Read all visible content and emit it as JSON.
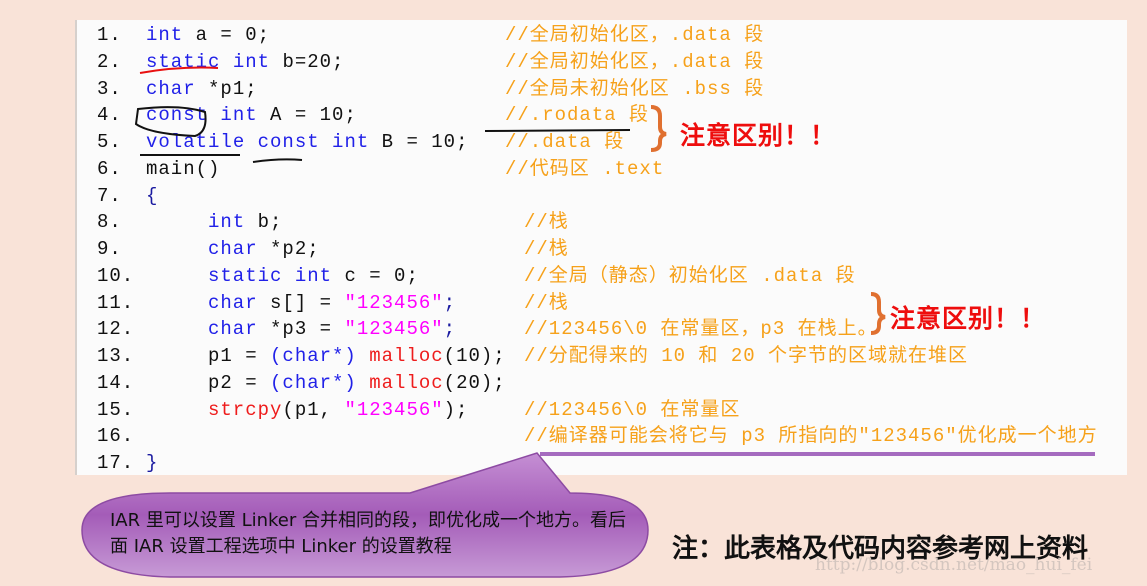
{
  "code_lines": [
    {
      "num": "1.",
      "indent": 0,
      "tokens": [
        [
          "int",
          "k"
        ],
        [
          " a = 0;",
          "p"
        ]
      ],
      "comment": "//全局初始化区，.data 段"
    },
    {
      "num": "2.",
      "indent": 0,
      "tokens": [
        [
          "static",
          "k"
        ],
        [
          " ",
          "p"
        ],
        [
          "int",
          "k"
        ],
        [
          " b=20;",
          "p"
        ]
      ],
      "comment": "//全局初始化区，.data 段"
    },
    {
      "num": "3.",
      "indent": 0,
      "tokens": [
        [
          "char",
          "k"
        ],
        [
          " *p1;",
          "p"
        ]
      ],
      "comment": "//全局未初始化区 .bss 段"
    },
    {
      "num": "4.",
      "indent": 0,
      "tokens": [
        [
          "const",
          "k"
        ],
        [
          " ",
          "p"
        ],
        [
          "int",
          "k"
        ],
        [
          " A = 10;",
          "p"
        ]
      ],
      "comment": "//.rodata 段"
    },
    {
      "num": "5.",
      "indent": 0,
      "tokens": [
        [
          "volatile",
          "k"
        ],
        [
          " ",
          "p"
        ],
        [
          "const",
          "k"
        ],
        [
          " ",
          "p"
        ],
        [
          "int",
          "k"
        ],
        [
          " B = 10;",
          "p"
        ]
      ],
      "comment": "//.data 段"
    },
    {
      "num": "6.",
      "indent": 0,
      "tokens": [
        [
          "main()",
          "p"
        ]
      ],
      "comment": "//代码区 .text"
    },
    {
      "num": "7.",
      "indent": 0,
      "tokens": [
        [
          "{",
          "b"
        ]
      ],
      "comment": ""
    },
    {
      "num": "8.",
      "indent": 1,
      "tokens": [
        [
          "int",
          "k"
        ],
        [
          " b;",
          "p"
        ]
      ],
      "comment": "//栈"
    },
    {
      "num": "9.",
      "indent": 1,
      "tokens": [
        [
          "char",
          "k"
        ],
        [
          " *p2;",
          "p"
        ]
      ],
      "comment": "//栈"
    },
    {
      "num": "10.",
      "indent": 1,
      "tokens": [
        [
          "static",
          "k"
        ],
        [
          " ",
          "p"
        ],
        [
          "int",
          "k"
        ],
        [
          " c = 0;",
          "p"
        ]
      ],
      "comment": "//全局（静态）初始化区 .data 段"
    },
    {
      "num": "11.",
      "indent": 1,
      "tokens": [
        [
          "char",
          "k"
        ],
        [
          " s[] = ",
          "p"
        ],
        [
          "\"123456\"",
          "s"
        ],
        [
          ";",
          "b"
        ]
      ],
      "comment": "//栈"
    },
    {
      "num": "12.",
      "indent": 1,
      "tokens": [
        [
          "char",
          "k"
        ],
        [
          " *p3 = ",
          "p"
        ],
        [
          "\"123456\"",
          "s"
        ],
        [
          ";",
          "b"
        ]
      ],
      "comment": "//123456\\0 在常量区，p3 在栈上。"
    },
    {
      "num": "13.",
      "indent": 1,
      "tokens": [
        [
          "p1 = ",
          "p"
        ],
        [
          "(char*)",
          "k"
        ],
        [
          " ",
          "p"
        ],
        [
          "malloc",
          "f"
        ],
        [
          "(10);",
          "p"
        ]
      ],
      "comment": "//分配得来的 10 和 20 个字节的区域就在堆区"
    },
    {
      "num": "14.",
      "indent": 1,
      "tokens": [
        [
          "p2 = ",
          "p"
        ],
        [
          "(char*)",
          "k"
        ],
        [
          " ",
          "p"
        ],
        [
          "malloc",
          "f"
        ],
        [
          "(20);",
          "p"
        ]
      ],
      "comment": ""
    },
    {
      "num": "15.",
      "indent": 1,
      "tokens": [
        [
          "strcpy",
          "f"
        ],
        [
          "(p1, ",
          "p"
        ],
        [
          "\"123456\"",
          "s"
        ],
        [
          ");",
          "p"
        ]
      ],
      "comment": "//123456\\0 在常量区"
    },
    {
      "num": "16.",
      "indent": 1,
      "tokens": [],
      "comment": "//编译器可能会将它与 p3 所指向的\"123456\"优化成一个地方"
    },
    {
      "num": "17.",
      "indent": 0,
      "tokens": [
        [
          "}",
          "b"
        ]
      ],
      "comment": ""
    }
  ],
  "annotations": {
    "note_1": "注意区别！！",
    "note_2": "注意区别！！",
    "callout": "IAR 里可以设置 Linker 合并相同的段，即优化成一个地方。看后面 IAR 设置工程选项中 Linker 的设置教程",
    "footnote": "注：此表格及代码内容参考网上资料",
    "watermark": "http://blog.csdn.net/mao_hui_fei"
  },
  "colors": {
    "background": "#f9e3d8",
    "keyword": "#2121e8",
    "string": "#ff00ff",
    "function": "#ee1c1c",
    "comment": "#f6a11a",
    "note": "#ee0d0d",
    "brace": "#e07030",
    "callout": "#b477c6"
  }
}
